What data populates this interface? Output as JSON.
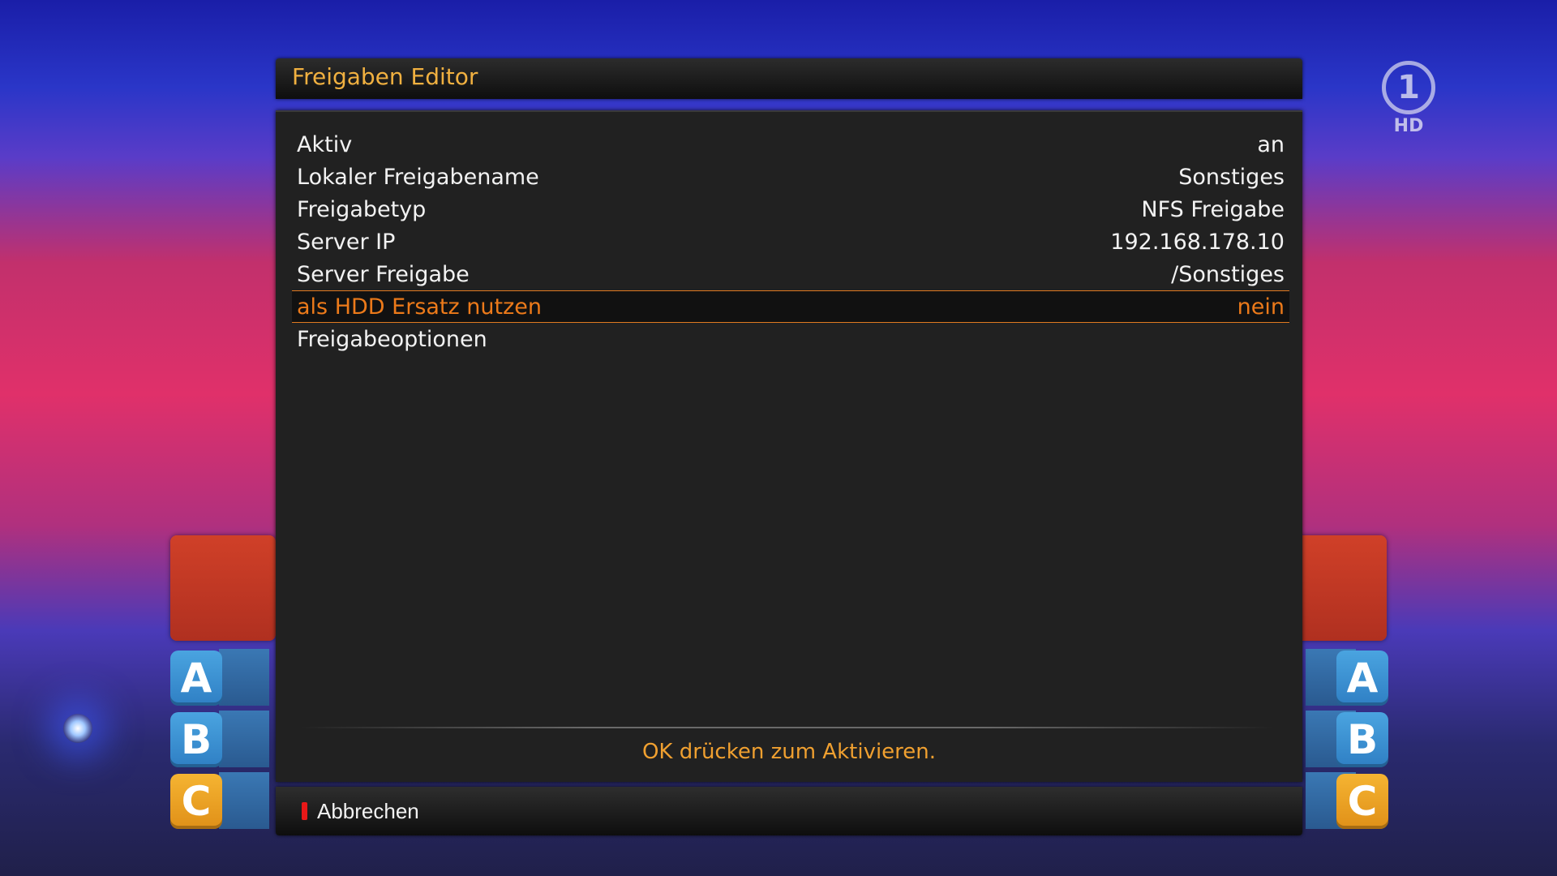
{
  "background": {
    "channel_logo": {
      "number": "1",
      "label": "HD"
    },
    "answer_tiles": [
      "A",
      "B",
      "C"
    ]
  },
  "dialog": {
    "title": "Freigaben Editor",
    "items": [
      {
        "label": "Aktiv",
        "value": "an",
        "selected": false
      },
      {
        "label": "Lokaler Freigabename",
        "value": "Sonstiges",
        "selected": false
      },
      {
        "label": "Freigabetyp",
        "value": "NFS Freigabe",
        "selected": false
      },
      {
        "label": "Server IP",
        "value": "192.168.178.10",
        "selected": false
      },
      {
        "label": "Server Freigabe",
        "value": "/Sonstiges",
        "selected": false
      },
      {
        "label": "als HDD Ersatz nutzen",
        "value": "nein",
        "selected": true
      },
      {
        "label": "Freigabeoptionen",
        "value": "",
        "selected": false
      }
    ],
    "help_text": "OK drücken zum Aktivieren.",
    "buttons": {
      "cancel_label": "Abbrechen",
      "cancel_key_color": "#e81818"
    }
  },
  "colors": {
    "title": "#f0b040",
    "selected_text": "#ec7a1a",
    "help_text": "#f0a030"
  }
}
